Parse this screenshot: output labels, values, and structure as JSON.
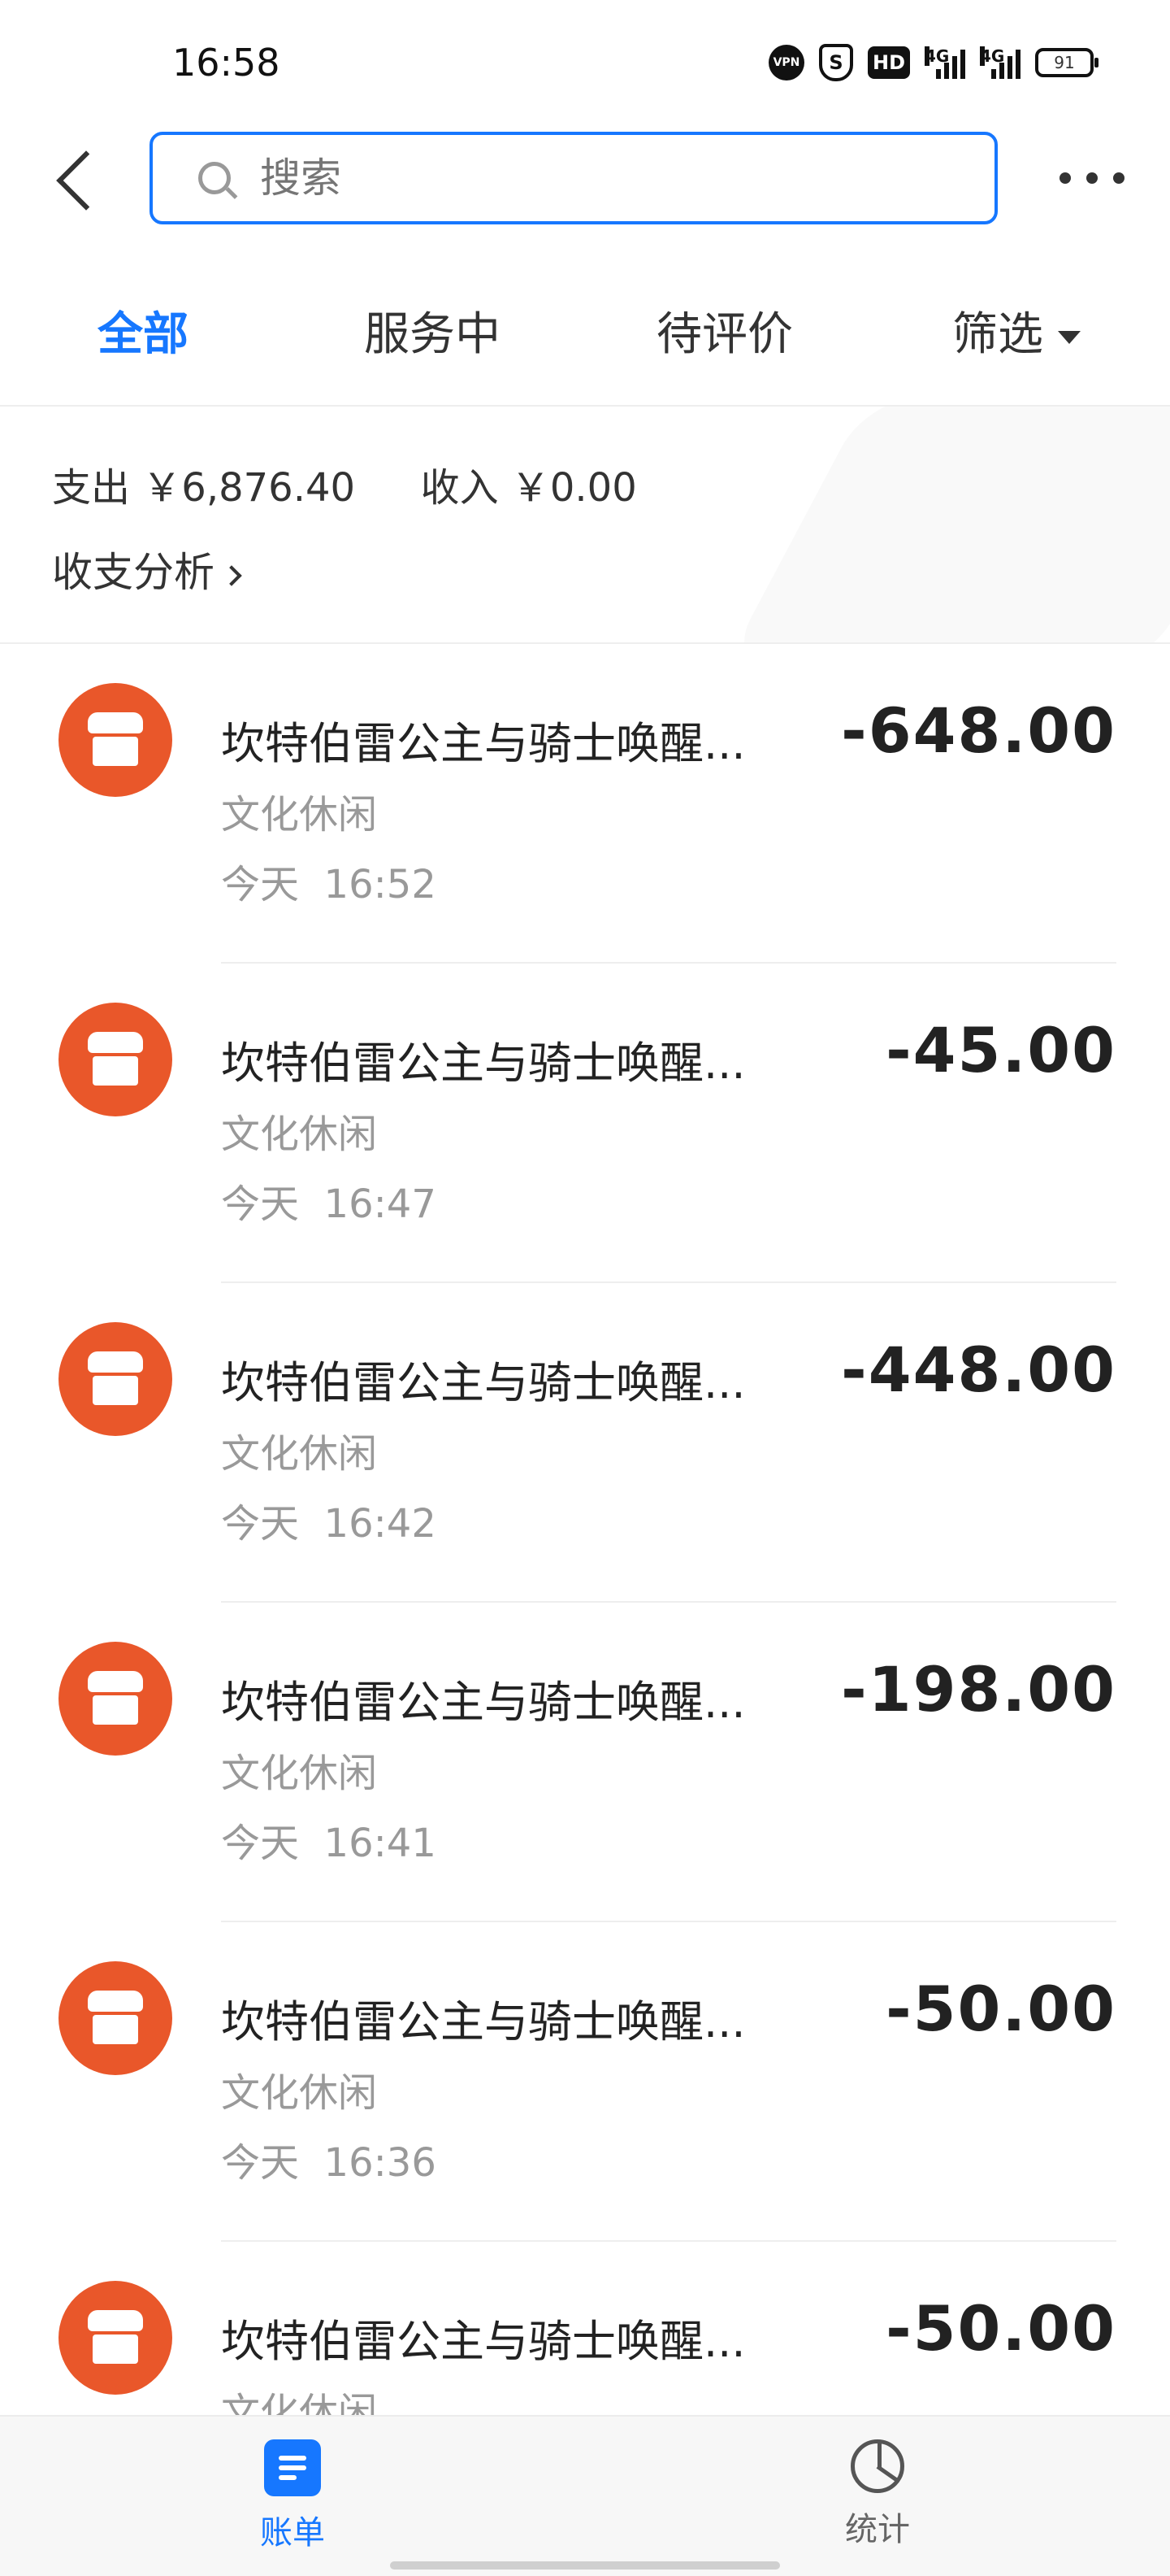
{
  "status_bar": {
    "time": "16:58",
    "icons": [
      "VPN",
      "S",
      "HD",
      "4G",
      "4G"
    ],
    "battery": "91"
  },
  "search": {
    "placeholder": "搜索"
  },
  "tabs": [
    {
      "label": "全部",
      "active": true
    },
    {
      "label": "服务中",
      "active": false
    },
    {
      "label": "待评价",
      "active": false
    },
    {
      "label": "筛选",
      "active": false
    }
  ],
  "summary": {
    "expense_label": "支出",
    "expense_value": "￥6,876.40",
    "income_label": "收入",
    "income_value": "￥0.00",
    "analysis_link": "收支分析"
  },
  "transactions": [
    {
      "title": "坎特伯雷公主与骑士唤醒...",
      "category": "文化休闲",
      "date": "今天",
      "time": "16:52",
      "amount": "-648.00"
    },
    {
      "title": "坎特伯雷公主与骑士唤醒...",
      "category": "文化休闲",
      "date": "今天",
      "time": "16:47",
      "amount": "-45.00"
    },
    {
      "title": "坎特伯雷公主与骑士唤醒...",
      "category": "文化休闲",
      "date": "今天",
      "time": "16:42",
      "amount": "-448.00"
    },
    {
      "title": "坎特伯雷公主与骑士唤醒...",
      "category": "文化休闲",
      "date": "今天",
      "time": "16:41",
      "amount": "-198.00"
    },
    {
      "title": "坎特伯雷公主与骑士唤醒...",
      "category": "文化休闲",
      "date": "今天",
      "time": "16:36",
      "amount": "-50.00"
    },
    {
      "title": "坎特伯雷公主与骑士唤醒...",
      "category": "文化休闲",
      "date": "",
      "time": "",
      "amount": "-50.00"
    }
  ],
  "bottom_nav": [
    {
      "label": "账单",
      "icon": "bill-icon",
      "active": true
    },
    {
      "label": "统计",
      "icon": "pie-chart-icon",
      "active": false
    }
  ],
  "colors": {
    "accent": "#1677ff",
    "merchant_icon": "#e9572a"
  }
}
